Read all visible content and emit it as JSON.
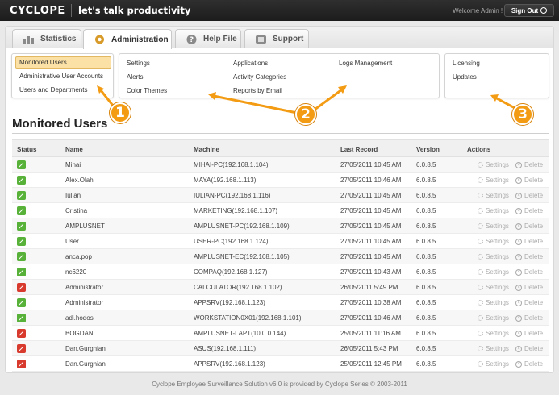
{
  "header": {
    "logo": "CYCLOPE",
    "tagline": "let's talk productivity",
    "welcome": "Welcome Admin !",
    "signout": "Sign Out"
  },
  "tabs": [
    {
      "label": "Statistics",
      "icon": "bar-chart-icon",
      "active": false
    },
    {
      "label": "Administration",
      "icon": "gear-icon",
      "active": true
    },
    {
      "label": "Help File",
      "icon": "help-icon",
      "active": false
    },
    {
      "label": "Support",
      "icon": "support-icon",
      "active": false
    }
  ],
  "submenu": {
    "group1": [
      "Monitored Users",
      "Administrative User Accounts",
      "Users and Departments"
    ],
    "group2_col1": [
      "Settings",
      "Alerts",
      "Color Themes"
    ],
    "group2_col2": [
      "Applications",
      "Activity Categories",
      "Reports by Email"
    ],
    "group2_col3": [
      "Logs Management"
    ],
    "group3": [
      "Licensing",
      "Updates"
    ]
  },
  "badges": [
    "1",
    "2",
    "3"
  ],
  "page": {
    "title": "Monitored Users"
  },
  "table": {
    "columns": [
      "Status",
      "Name",
      "Machine",
      "Last Record",
      "Version",
      "Actions"
    ],
    "settings_label": "Settings",
    "delete_label": "Delete",
    "rows": [
      {
        "status": "online",
        "name": "Mihai",
        "machine": "MIHAI-PC(192.168.1.104)",
        "last": "27/05/2011 10:45 AM",
        "version": "6.0.8.5"
      },
      {
        "status": "online",
        "name": "Alex.Olah",
        "machine": "MAYA(192.168.1.113)",
        "last": "27/05/2011 10:46 AM",
        "version": "6.0.8.5"
      },
      {
        "status": "online",
        "name": "Iulian",
        "machine": "IULIAN-PC(192.168.1.116)",
        "last": "27/05/2011 10:45 AM",
        "version": "6.0.8.5"
      },
      {
        "status": "online",
        "name": "Cristina",
        "machine": "MARKETING(192.168.1.107)",
        "last": "27/05/2011 10:45 AM",
        "version": "6.0.8.5"
      },
      {
        "status": "online",
        "name": "AMPLUSNET",
        "machine": "AMPLUSNET-PC(192.168.1.109)",
        "last": "27/05/2011 10:45 AM",
        "version": "6.0.8.5"
      },
      {
        "status": "online",
        "name": "User",
        "machine": "USER-PC(192.168.1.124)",
        "last": "27/05/2011 10:45 AM",
        "version": "6.0.8.5"
      },
      {
        "status": "online",
        "name": "anca.pop",
        "machine": "AMPLUSNET-EC(192.168.1.105)",
        "last": "27/05/2011 10:45 AM",
        "version": "6.0.8.5"
      },
      {
        "status": "online",
        "name": "nc6220",
        "machine": "COMPAQ(192.168.1.127)",
        "last": "27/05/2011 10:43 AM",
        "version": "6.0.8.5"
      },
      {
        "status": "offline",
        "name": "Administrator",
        "machine": "CALCULATOR(192.168.1.102)",
        "last": "26/05/2011 5:49 PM",
        "version": "6.0.8.5"
      },
      {
        "status": "online",
        "name": "Administrator",
        "machine": "APPSRV(192.168.1.123)",
        "last": "27/05/2011 10:38 AM",
        "version": "6.0.8.5"
      },
      {
        "status": "online",
        "name": "adi.hodos",
        "machine": "WORKSTATION0X01(192.168.1.101)",
        "last": "27/05/2011 10:46 AM",
        "version": "6.0.8.5"
      },
      {
        "status": "offline",
        "name": "BOGDAN",
        "machine": "AMPLUSNET-LAPT(10.0.0.144)",
        "last": "25/05/2011 11:16 AM",
        "version": "6.0.8.5"
      },
      {
        "status": "offline",
        "name": "Dan.Gurghian",
        "machine": "ASUS(192.168.1.111)",
        "last": "26/05/2011 5:43 PM",
        "version": "6.0.8.5"
      },
      {
        "status": "offline",
        "name": "Dan.Gurghian",
        "machine": "APPSRV(192.168.1.123)",
        "last": "25/05/2011 12:45 PM",
        "version": "6.0.8.5"
      }
    ]
  },
  "footer": "Cyclope Employee Surveillance Solution v6.0 is provided by Cyclope Series © 2003-2011"
}
